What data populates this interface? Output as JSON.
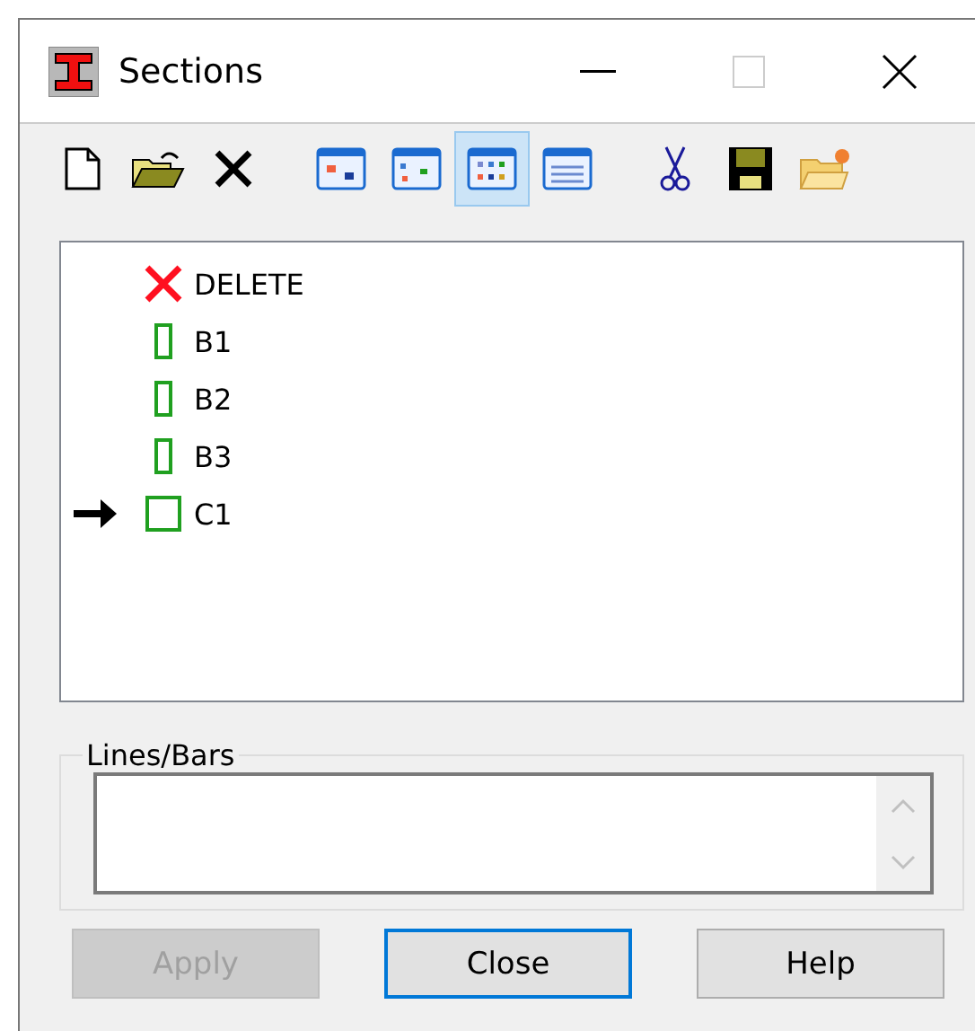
{
  "window": {
    "title": "Sections"
  },
  "toolbar": [
    {
      "kind": "new",
      "pressed": false
    },
    {
      "kind": "open",
      "pressed": false
    },
    {
      "kind": "delete",
      "pressed": false
    },
    {
      "kind": "view1",
      "pressed": false
    },
    {
      "kind": "view2",
      "pressed": false
    },
    {
      "kind": "view3",
      "pressed": true
    },
    {
      "kind": "view4",
      "pressed": false
    },
    {
      "kind": "cut",
      "pressed": false
    },
    {
      "kind": "save",
      "pressed": false
    },
    {
      "kind": "folder",
      "pressed": false
    }
  ],
  "sections": [
    {
      "kind": "delete",
      "label": "DELETE",
      "current": false
    },
    {
      "kind": "bar",
      "label": "B1",
      "current": false
    },
    {
      "kind": "bar",
      "label": "B2",
      "current": false
    },
    {
      "kind": "bar",
      "label": "B3",
      "current": false
    },
    {
      "kind": "column",
      "label": "C1",
      "current": true
    }
  ],
  "lines_bars": {
    "label": "Lines/Bars"
  },
  "buttons": [
    {
      "label": "Apply",
      "disabled": true,
      "default": false
    },
    {
      "label": "Close",
      "disabled": false,
      "default": true
    },
    {
      "label": "Help",
      "disabled": false,
      "default": false
    }
  ]
}
